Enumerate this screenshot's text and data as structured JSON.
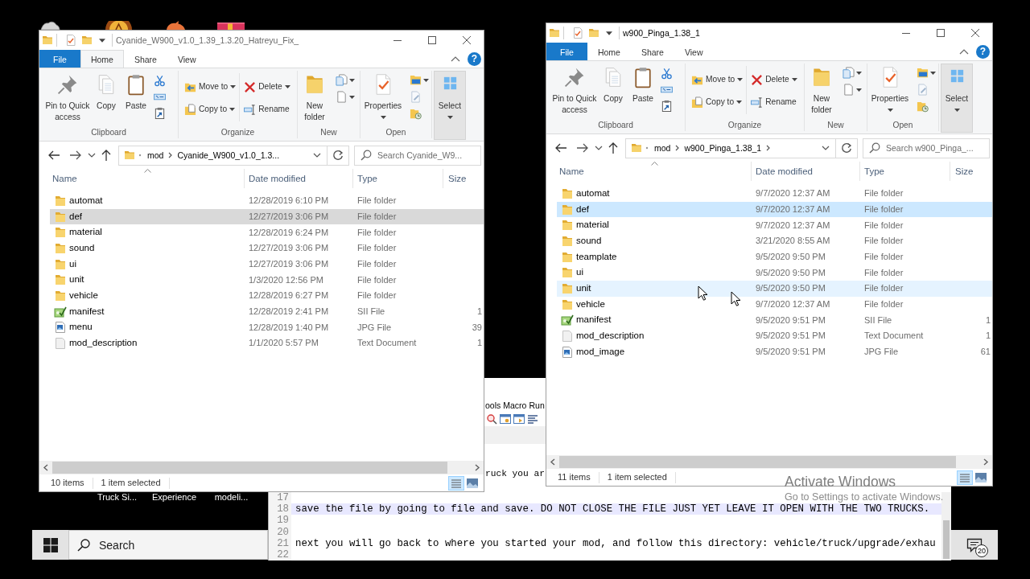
{
  "windows": [
    {
      "title": "Cyanide_W900_v1.0_1.39_1.3.20_Hatreyu_Fix_",
      "active": false,
      "tabs": [
        {
          "label": "File",
          "kind": "file",
          "selected": false
        },
        {
          "label": "Home",
          "kind": "tab",
          "selected": true
        },
        {
          "label": "Share",
          "kind": "tab",
          "selected": false
        },
        {
          "label": "View",
          "kind": "tab",
          "selected": false
        }
      ],
      "help": "?",
      "ribbon": [
        {
          "label": "Clipboard",
          "items": [
            "Pin to Quick access",
            "Copy",
            "Paste"
          ]
        },
        {
          "label": "Organize",
          "items": [
            "Move to",
            "Copy to",
            "Delete",
            "Rename"
          ]
        },
        {
          "label": "New",
          "items": [
            "New folder"
          ]
        },
        {
          "label": "Open",
          "items": [
            "Properties"
          ]
        },
        {
          "items": [
            "Select"
          ]
        }
      ],
      "address": {
        "path": [
          "mod",
          "Cyanide_W900_v1.0_1.3..."
        ]
      },
      "search": {
        "placeholder": "Search Cyanide_W9..."
      },
      "columns": [
        {
          "label": "Name",
          "sorted": true
        },
        {
          "label": "Date modified",
          "sorted": false
        },
        {
          "label": "Type",
          "sorted": false
        },
        {
          "label": "Size",
          "sorted": false
        }
      ],
      "rows": [
        {
          "kind": "folder",
          "name": "automat",
          "date": "12/28/2019 6:10 PM",
          "type": "File folder",
          "selected": false
        },
        {
          "kind": "folder",
          "name": "def",
          "date": "12/27/2019 3:06 PM",
          "type": "File folder",
          "selected": true
        },
        {
          "kind": "folder",
          "name": "material",
          "date": "12/28/2019 6:24 PM",
          "type": "File folder",
          "selected": false
        },
        {
          "kind": "folder",
          "name": "sound",
          "date": "12/27/2019 3:06 PM",
          "type": "File folder",
          "selected": false
        },
        {
          "kind": "folder",
          "name": "ui",
          "date": "12/27/2019 3:06 PM",
          "type": "File folder",
          "selected": false
        },
        {
          "kind": "folder",
          "name": "unit",
          "date": "1/3/2020 12:56 PM",
          "type": "File folder",
          "selected": false
        },
        {
          "kind": "folder",
          "name": "vehicle",
          "date": "12/28/2019 6:27 PM",
          "type": "File folder",
          "selected": false
        },
        {
          "kind": "sii",
          "name": "manifest",
          "date": "12/28/2019 2:41 PM",
          "type": "SII File",
          "size": "1",
          "selected": false
        },
        {
          "kind": "image",
          "name": "menu",
          "date": "12/28/2019 1:40 PM",
          "type": "JPG File",
          "size": "39",
          "selected": false
        },
        {
          "kind": "text",
          "name": "mod_description",
          "date": "1/1/2020 5:57 PM",
          "type": "Text Document",
          "size": "1",
          "selected": false
        }
      ],
      "status": {
        "count": "10 items",
        "selection": "1 item selected"
      },
      "views": [
        {
          "kind": "details",
          "selected": true
        },
        {
          "kind": "large_icons",
          "selected": false
        }
      ]
    },
    {
      "title": "w900_Pinga_1.38_1",
      "active": true,
      "tabs": [
        {
          "label": "File",
          "kind": "file",
          "selected": false
        },
        {
          "label": "Home",
          "kind": "tab",
          "selected": false
        },
        {
          "label": "Share",
          "kind": "tab",
          "selected": false
        },
        {
          "label": "View",
          "kind": "tab",
          "selected": false
        }
      ],
      "help": "?",
      "ribbon": [
        {
          "label": "Clipboard",
          "items": [
            "Pin to Quick access",
            "Copy",
            "Paste"
          ]
        },
        {
          "label": "Organize",
          "items": [
            "Move to",
            "Copy to",
            "Delete",
            "Rename"
          ]
        },
        {
          "label": "New",
          "items": [
            "New folder"
          ]
        },
        {
          "label": "Open",
          "items": [
            "Properties"
          ]
        },
        {
          "items": [
            "Select"
          ]
        }
      ],
      "address": {
        "path": [
          "mod",
          "w900_Pinga_1.38_1"
        ],
        "trailing_chevron": true
      },
      "search": {
        "placeholder": "Search w900_Pinga_..."
      },
      "columns": [
        {
          "label": "Name",
          "sorted": true
        },
        {
          "label": "Date modified",
          "sorted": false
        },
        {
          "label": "Type",
          "sorted": false
        },
        {
          "label": "Size",
          "sorted": false
        }
      ],
      "rows": [
        {
          "kind": "folder",
          "name": "automat",
          "date": "9/7/2020 12:37 AM",
          "type": "File folder",
          "selected": false,
          "hovered": false
        },
        {
          "kind": "folder",
          "name": "def",
          "date": "9/7/2020 12:37 AM",
          "type": "File folder",
          "selected": true,
          "hovered": false
        },
        {
          "kind": "folder",
          "name": "material",
          "date": "9/7/2020 12:37 AM",
          "type": "File folder",
          "selected": false,
          "hovered": false
        },
        {
          "kind": "folder",
          "name": "sound",
          "date": "3/21/2020 8:55 AM",
          "type": "File folder",
          "selected": false,
          "hovered": false
        },
        {
          "kind": "folder",
          "name": "teamplate",
          "date": "9/5/2020 9:50 PM",
          "type": "File folder",
          "selected": false,
          "hovered": false
        },
        {
          "kind": "folder",
          "name": "ui",
          "date": "9/5/2020 9:50 PM",
          "type": "File folder",
          "selected": false,
          "hovered": false
        },
        {
          "kind": "folder",
          "name": "unit",
          "date": "9/5/2020 9:50 PM",
          "type": "File folder",
          "selected": false,
          "hovered": true
        },
        {
          "kind": "folder",
          "name": "vehicle",
          "date": "9/7/2020 12:37 AM",
          "type": "File folder",
          "selected": false,
          "hovered": false
        },
        {
          "kind": "sii",
          "name": "manifest",
          "date": "9/5/2020 9:51 PM",
          "type": "SII File",
          "size": "1",
          "selected": false,
          "hovered": false
        },
        {
          "kind": "text",
          "name": "mod_description",
          "date": "9/5/2020 9:51 PM",
          "type": "Text Document",
          "size": "1",
          "selected": false,
          "hovered": false
        },
        {
          "kind": "image",
          "name": "mod_image",
          "date": "9/5/2020 9:51 PM",
          "type": "JPG File",
          "size": "61",
          "selected": false,
          "hovered": false
        }
      ],
      "status": {
        "count": "11 items",
        "selection": "1 item selected"
      },
      "views": [
        {
          "kind": "details",
          "selected": true
        },
        {
          "kind": "large_icons",
          "selected": false
        }
      ]
    }
  ],
  "editor": {
    "menu": [
      "ools",
      "Macro",
      "Run"
    ],
    "fragment": "ruck you ar",
    "lines": [
      {
        "number": "17",
        "highlighted": false
      },
      {
        "number": "18",
        "text": "save the file by going to file and save. DO NOT CLOSE THE FILE JUST YET LEAVE IT OPEN WITH THE TWO TRUCKS.",
        "highlighted": true
      },
      {
        "number": "19",
        "highlighted": false
      },
      {
        "number": "20",
        "highlighted": false
      },
      {
        "number": "21",
        "text": "next you will go back to where you started your mod, and follow this directory: vehicle/truck/upgrade/exhau",
        "highlighted": false
      },
      {
        "number": "22",
        "highlighted": false
      }
    ]
  },
  "desktop": {
    "icon_labels": [
      "Truck Si...",
      "Experience",
      "modeli..."
    ]
  },
  "taskbar": {
    "placeholder": "Search",
    "notifications": "20"
  },
  "activation": {
    "title": "Activate Windows",
    "message": "Go to Settings to activate Windows."
  }
}
